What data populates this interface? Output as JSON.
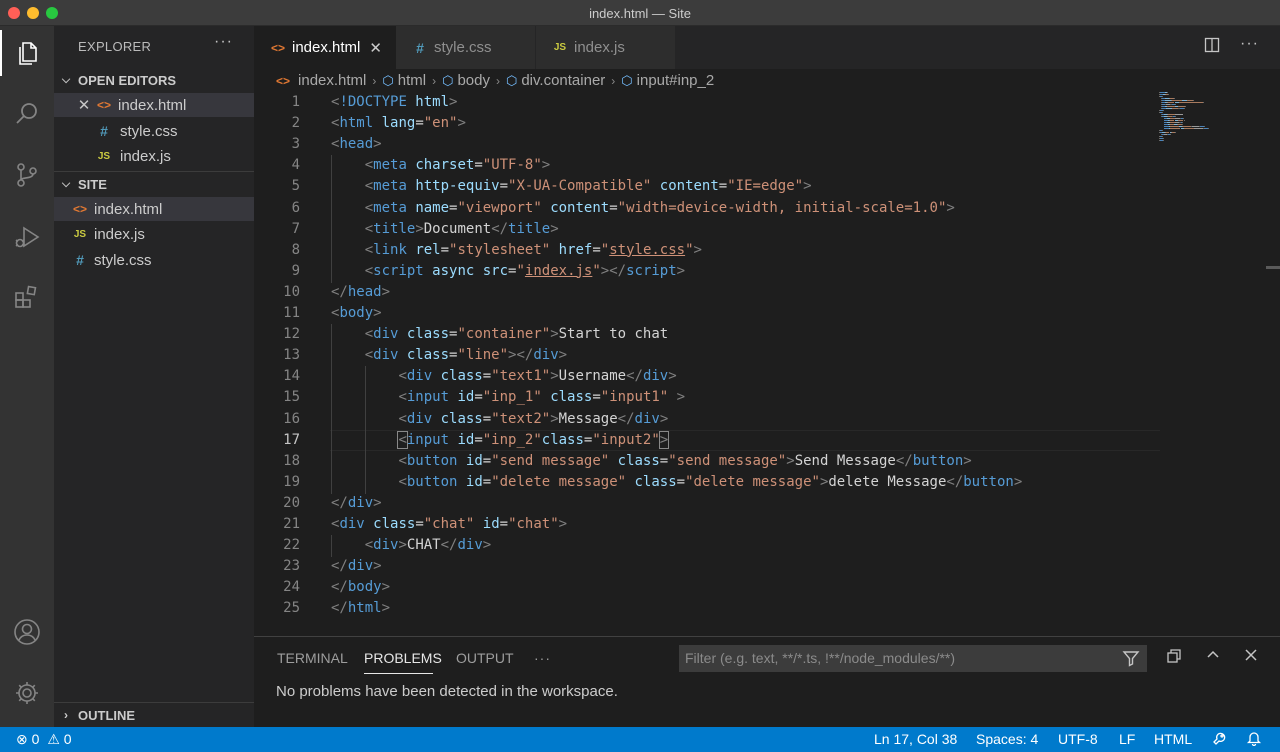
{
  "window": {
    "title": "index.html — Site"
  },
  "activity_bar": {
    "icons": [
      "files-icon",
      "search-icon",
      "source-control-icon",
      "run-debug-icon",
      "extensions-icon",
      "account-icon",
      "settings-gear-icon"
    ]
  },
  "sidebar": {
    "title": "EXPLORER",
    "more": "···",
    "open_editors": {
      "label": "OPEN EDITORS",
      "files": [
        {
          "name": "index.html",
          "type": "html"
        },
        {
          "name": "style.css",
          "type": "css"
        },
        {
          "name": "index.js",
          "type": "js"
        }
      ]
    },
    "folder": {
      "label": "SITE",
      "files": [
        {
          "name": "index.html",
          "type": "html"
        },
        {
          "name": "index.js",
          "type": "js"
        },
        {
          "name": "style.css",
          "type": "css"
        }
      ]
    },
    "outline_label": "OUTLINE"
  },
  "tabs": [
    {
      "label": "index.html",
      "type": "html",
      "active": true
    },
    {
      "label": "style.css",
      "type": "css",
      "active": false
    },
    {
      "label": "index.js",
      "type": "js",
      "active": false
    }
  ],
  "breadcrumb": [
    "index.html",
    "html",
    "body",
    "div.container",
    "input#inp_2"
  ],
  "editor": {
    "current_line": 17,
    "lines": [
      {
        "n": 1,
        "indent": 0,
        "tokens": [
          [
            "punct",
            "<"
          ],
          [
            "tag",
            "!DOCTYPE "
          ],
          [
            "attr",
            "html"
          ],
          [
            "punct",
            ">"
          ]
        ]
      },
      {
        "n": 2,
        "indent": 0,
        "tokens": [
          [
            "punct",
            "<"
          ],
          [
            "tag",
            "html "
          ],
          [
            "attr",
            "lang"
          ],
          [
            "txt",
            "="
          ],
          [
            "str",
            "\"en\""
          ],
          [
            "punct",
            ">"
          ]
        ]
      },
      {
        "n": 3,
        "indent": 0,
        "tokens": [
          [
            "punct",
            "<"
          ],
          [
            "tag",
            "head"
          ],
          [
            "punct",
            ">"
          ]
        ]
      },
      {
        "n": 4,
        "indent": 1,
        "tokens": [
          [
            "punct",
            "<"
          ],
          [
            "tag",
            "meta "
          ],
          [
            "attr",
            "charset"
          ],
          [
            "txt",
            "="
          ],
          [
            "str",
            "\"UTF-8\""
          ],
          [
            "punct",
            ">"
          ]
        ]
      },
      {
        "n": 5,
        "indent": 1,
        "tokens": [
          [
            "punct",
            "<"
          ],
          [
            "tag",
            "meta "
          ],
          [
            "attr",
            "http-equiv"
          ],
          [
            "txt",
            "="
          ],
          [
            "str",
            "\"X-UA-Compatible\""
          ],
          [
            "txt",
            " "
          ],
          [
            "attr",
            "content"
          ],
          [
            "txt",
            "="
          ],
          [
            "str",
            "\"IE=edge\""
          ],
          [
            "punct",
            ">"
          ]
        ]
      },
      {
        "n": 6,
        "indent": 1,
        "tokens": [
          [
            "punct",
            "<"
          ],
          [
            "tag",
            "meta "
          ],
          [
            "attr",
            "name"
          ],
          [
            "txt",
            "="
          ],
          [
            "str",
            "\"viewport\""
          ],
          [
            "txt",
            " "
          ],
          [
            "attr",
            "content"
          ],
          [
            "txt",
            "="
          ],
          [
            "str",
            "\"width=device-width, initial-scale=1.0\""
          ],
          [
            "punct",
            ">"
          ]
        ]
      },
      {
        "n": 7,
        "indent": 1,
        "tokens": [
          [
            "punct",
            "<"
          ],
          [
            "tag",
            "title"
          ],
          [
            "punct",
            ">"
          ],
          [
            "txt",
            "Document"
          ],
          [
            "punct",
            "</"
          ],
          [
            "tag",
            "title"
          ],
          [
            "punct",
            ">"
          ]
        ]
      },
      {
        "n": 8,
        "indent": 1,
        "tokens": [
          [
            "punct",
            "<"
          ],
          [
            "tag",
            "link "
          ],
          [
            "attr",
            "rel"
          ],
          [
            "txt",
            "="
          ],
          [
            "str",
            "\"stylesheet\""
          ],
          [
            "txt",
            " "
          ],
          [
            "attr",
            "href"
          ],
          [
            "txt",
            "="
          ],
          [
            "str",
            "\""
          ],
          [
            "strlink",
            "style.css"
          ],
          [
            "str",
            "\""
          ],
          [
            "punct",
            ">"
          ]
        ]
      },
      {
        "n": 9,
        "indent": 1,
        "tokens": [
          [
            "punct",
            "<"
          ],
          [
            "tag",
            "script "
          ],
          [
            "attr",
            "async "
          ],
          [
            "attr",
            "src"
          ],
          [
            "txt",
            "="
          ],
          [
            "str",
            "\""
          ],
          [
            "strlink",
            "index.js"
          ],
          [
            "str",
            "\""
          ],
          [
            "punct",
            "></"
          ],
          [
            "tag",
            "script"
          ],
          [
            "punct",
            ">"
          ]
        ]
      },
      {
        "n": 10,
        "indent": 0,
        "tokens": [
          [
            "punct",
            "</"
          ],
          [
            "tag",
            "head"
          ],
          [
            "punct",
            ">"
          ]
        ]
      },
      {
        "n": 11,
        "indent": 0,
        "tokens": [
          [
            "punct",
            "<"
          ],
          [
            "tag",
            "body"
          ],
          [
            "punct",
            ">"
          ]
        ]
      },
      {
        "n": 12,
        "indent": 1,
        "tokens": [
          [
            "punct",
            "<"
          ],
          [
            "tag",
            "div "
          ],
          [
            "attr",
            "class"
          ],
          [
            "txt",
            "="
          ],
          [
            "str",
            "\"container\""
          ],
          [
            "punct",
            ">"
          ],
          [
            "txt",
            "Start to chat"
          ]
        ]
      },
      {
        "n": 13,
        "indent": 1,
        "tokens": [
          [
            "punct",
            "<"
          ],
          [
            "tag",
            "div "
          ],
          [
            "attr",
            "class"
          ],
          [
            "txt",
            "="
          ],
          [
            "str",
            "\"line\""
          ],
          [
            "punct",
            "></"
          ],
          [
            "tag",
            "div"
          ],
          [
            "punct",
            ">"
          ]
        ]
      },
      {
        "n": 14,
        "indent": 2,
        "tokens": [
          [
            "punct",
            "<"
          ],
          [
            "tag",
            "div "
          ],
          [
            "attr",
            "class"
          ],
          [
            "txt",
            "="
          ],
          [
            "str",
            "\"text1\""
          ],
          [
            "punct",
            ">"
          ],
          [
            "txt",
            "Username"
          ],
          [
            "punct",
            "</"
          ],
          [
            "tag",
            "div"
          ],
          [
            "punct",
            ">"
          ]
        ]
      },
      {
        "n": 15,
        "indent": 2,
        "tokens": [
          [
            "punct",
            "<"
          ],
          [
            "tag",
            "input "
          ],
          [
            "attr",
            "id"
          ],
          [
            "txt",
            "="
          ],
          [
            "str",
            "\"inp_1\""
          ],
          [
            "txt",
            " "
          ],
          [
            "attr",
            "class"
          ],
          [
            "txt",
            "="
          ],
          [
            "str",
            "\"input1\""
          ],
          [
            "txt",
            " "
          ],
          [
            "punct",
            ">"
          ]
        ]
      },
      {
        "n": 16,
        "indent": 2,
        "tokens": [
          [
            "punct",
            "<"
          ],
          [
            "tag",
            "div "
          ],
          [
            "attr",
            "class"
          ],
          [
            "txt",
            "="
          ],
          [
            "str",
            "\"text2\""
          ],
          [
            "punct",
            ">"
          ],
          [
            "txt",
            "Message"
          ],
          [
            "punct",
            "</"
          ],
          [
            "tag",
            "div"
          ],
          [
            "punct",
            ">"
          ]
        ]
      },
      {
        "n": 17,
        "indent": 2,
        "tokens": [
          [
            "punctbox",
            "<"
          ],
          [
            "tag",
            "input "
          ],
          [
            "attr",
            "id"
          ],
          [
            "txt",
            "="
          ],
          [
            "str",
            "\"inp_2\""
          ],
          [
            "attr",
            "class"
          ],
          [
            "txt",
            "="
          ],
          [
            "str",
            "\"input2\""
          ],
          [
            "punctbox",
            ">"
          ]
        ]
      },
      {
        "n": 18,
        "indent": 2,
        "tokens": [
          [
            "punct",
            "<"
          ],
          [
            "tag",
            "button "
          ],
          [
            "attr",
            "id"
          ],
          [
            "txt",
            "="
          ],
          [
            "str",
            "\"send message\""
          ],
          [
            "txt",
            " "
          ],
          [
            "attr",
            "class"
          ],
          [
            "txt",
            "="
          ],
          [
            "str",
            "\"send message\""
          ],
          [
            "punct",
            ">"
          ],
          [
            "txt",
            "Send Message"
          ],
          [
            "punct",
            "</"
          ],
          [
            "tag",
            "button"
          ],
          [
            "punct",
            ">"
          ]
        ]
      },
      {
        "n": 19,
        "indent": 2,
        "tokens": [
          [
            "punct",
            "<"
          ],
          [
            "tag",
            "button "
          ],
          [
            "attr",
            "id"
          ],
          [
            "txt",
            "="
          ],
          [
            "str",
            "\"delete message\""
          ],
          [
            "txt",
            " "
          ],
          [
            "attr",
            "class"
          ],
          [
            "txt",
            "="
          ],
          [
            "str",
            "\"delete message\""
          ],
          [
            "punct",
            ">"
          ],
          [
            "txt",
            "delete Message"
          ],
          [
            "punct",
            "</"
          ],
          [
            "tag",
            "button"
          ],
          [
            "punct",
            ">"
          ]
        ]
      },
      {
        "n": 20,
        "indent": 0,
        "tokens": [
          [
            "punct",
            "</"
          ],
          [
            "tag",
            "div"
          ],
          [
            "punct",
            ">"
          ]
        ]
      },
      {
        "n": 21,
        "indent": 0,
        "tokens": [
          [
            "punct",
            "<"
          ],
          [
            "tag",
            "div "
          ],
          [
            "attr",
            "class"
          ],
          [
            "txt",
            "="
          ],
          [
            "str",
            "\"chat\""
          ],
          [
            "txt",
            " "
          ],
          [
            "attr",
            "id"
          ],
          [
            "txt",
            "="
          ],
          [
            "str",
            "\"chat\""
          ],
          [
            "punct",
            ">"
          ]
        ]
      },
      {
        "n": 22,
        "indent": 1,
        "tokens": [
          [
            "punct",
            "<"
          ],
          [
            "tag",
            "div"
          ],
          [
            "punct",
            ">"
          ],
          [
            "txt",
            "CHAT"
          ],
          [
            "punct",
            "</"
          ],
          [
            "tag",
            "div"
          ],
          [
            "punct",
            ">"
          ]
        ]
      },
      {
        "n": 23,
        "indent": 0,
        "tokens": [
          [
            "punct",
            "</"
          ],
          [
            "tag",
            "div"
          ],
          [
            "punct",
            ">"
          ]
        ]
      },
      {
        "n": 24,
        "indent": 0,
        "tokens": [
          [
            "punct",
            "</"
          ],
          [
            "tag",
            "body"
          ],
          [
            "punct",
            ">"
          ]
        ]
      },
      {
        "n": 25,
        "indent": 0,
        "tokens": [
          [
            "punct",
            "</"
          ],
          [
            "tag",
            "html"
          ],
          [
            "punct",
            ">"
          ]
        ]
      }
    ]
  },
  "panel": {
    "tabs": [
      "TERMINAL",
      "PROBLEMS",
      "OUTPUT"
    ],
    "active_tab": "PROBLEMS",
    "more": "···",
    "filter_placeholder": "Filter (e.g. text, **/*.ts, !**/node_modules/**)",
    "message": "No problems have been detected in the workspace."
  },
  "statusbar": {
    "errors": "0",
    "warnings": "0",
    "position": "Ln 17, Col 38",
    "spaces": "Spaces: 4",
    "encoding": "UTF-8",
    "eol": "LF",
    "language": "HTML"
  },
  "colors": {
    "status_bar": "#007acc",
    "tag": "#569cd6",
    "attribute": "#9cdcfe",
    "string": "#ce9178",
    "html_icon": "#e37933",
    "css_icon": "#519aba",
    "js_icon": "#cbcb41"
  }
}
